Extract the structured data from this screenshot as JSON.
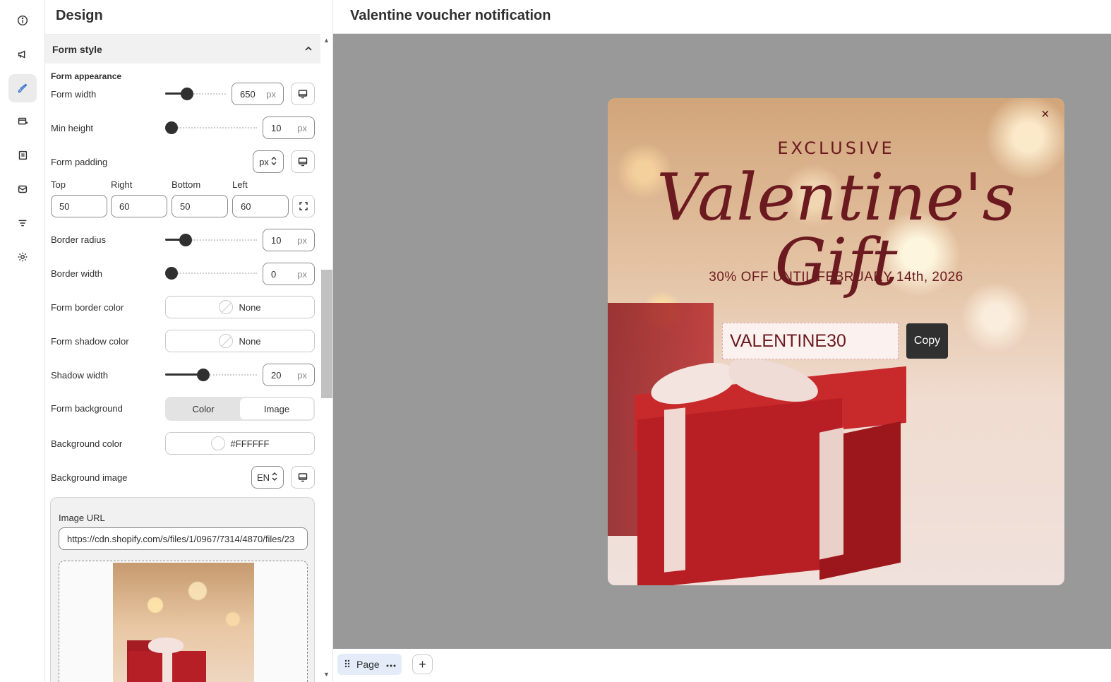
{
  "rail": {
    "icons": [
      "info-icon",
      "megaphone-icon",
      "brush-icon",
      "layout-icon",
      "content-icon",
      "email-icon",
      "filter-icon",
      "settings-icon"
    ],
    "active": "brush-icon"
  },
  "panel": {
    "title": "Design",
    "section_title": "Form style",
    "appearance_title": "Form appearance",
    "form_width": {
      "label": "Form width",
      "value": "650",
      "unit": "px",
      "level": 0.32
    },
    "min_height": {
      "label": "Min height",
      "value": "10",
      "unit": "px",
      "level": 0.0
    },
    "form_padding": {
      "label": "Form padding",
      "unit_select": "px",
      "sides": [
        {
          "label": "Top",
          "value": "50"
        },
        {
          "label": "Right",
          "value": "60"
        },
        {
          "label": "Bottom",
          "value": "50"
        },
        {
          "label": "Left",
          "value": "60"
        }
      ]
    },
    "border_radius": {
      "label": "Border radius",
      "value": "10",
      "unit": "px",
      "level": 0.18
    },
    "border_width": {
      "label": "Border width",
      "value": "0",
      "unit": "px",
      "level": 0.0
    },
    "form_border_color": {
      "label": "Form border color",
      "value": "None"
    },
    "form_shadow_color": {
      "label": "Form shadow color",
      "value": "None"
    },
    "shadow_width": {
      "label": "Shadow width",
      "value": "20",
      "unit": "px",
      "level": 0.4
    },
    "form_background": {
      "label": "Form background",
      "options": [
        "Color",
        "Image"
      ],
      "selected": "Image"
    },
    "background_color": {
      "label": "Background color",
      "value": "#FFFFFF"
    },
    "background_image": {
      "label": "Background image",
      "lang": "EN",
      "url_label": "Image URL",
      "url": "https://cdn.shopify.com/s/files/1/0967/7314/4870/files/23"
    }
  },
  "preview": {
    "title": "Valentine voucher notification",
    "popup": {
      "close": "×",
      "kicker": "EXCLUSIVE",
      "headline": "Valentine's Gift",
      "offer": "30% OFF UNTIL FEBRUARY 14th, 2026",
      "code": "VALENTINE30",
      "copy_label": "Copy"
    },
    "page_tab": "Page",
    "add_page": "+"
  },
  "colors": {
    "accent": "#2c6ecb",
    "popup_text": "#6b1a1f",
    "canvas": "#999999"
  }
}
